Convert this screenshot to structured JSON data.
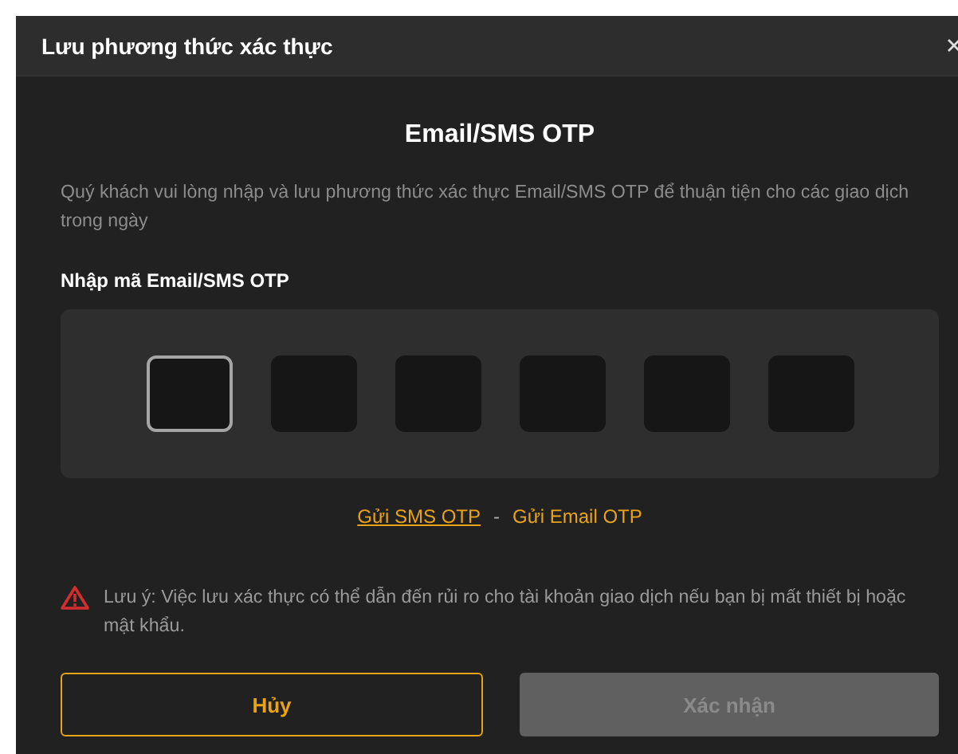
{
  "dialog": {
    "title": "Lưu phương thức xác thực"
  },
  "heading": "Email/SMS OTP",
  "description": "Quý khách vui lòng nhập và lưu phương thức xác thực Email/SMS OTP để thuận tiện cho các giao dịch trong ngày",
  "otp": {
    "label": "Nhập mã Email/SMS OTP",
    "digits": [
      {
        "selected": true
      },
      {
        "selected": false
      },
      {
        "selected": false
      },
      {
        "selected": false
      },
      {
        "selected": false
      },
      {
        "selected": false
      }
    ]
  },
  "links": [
    {
      "label": "Gửi SMS OTP",
      "underlined": true
    },
    {
      "label": "Gửi Email OTP",
      "underlined": false
    }
  ],
  "separator": "-",
  "warning": "Lưu ý: Việc lưu xác thực có thể dẫn đến rủi ro cho tài khoản giao dịch nếu bạn bị mất thiết bị hoặc mật khẩu.",
  "buttons": [
    {
      "label": "Hủy",
      "kind": "outline",
      "disabled": false
    },
    {
      "label": "Xác nhận",
      "kind": "primary",
      "disabled": true
    }
  ]
}
